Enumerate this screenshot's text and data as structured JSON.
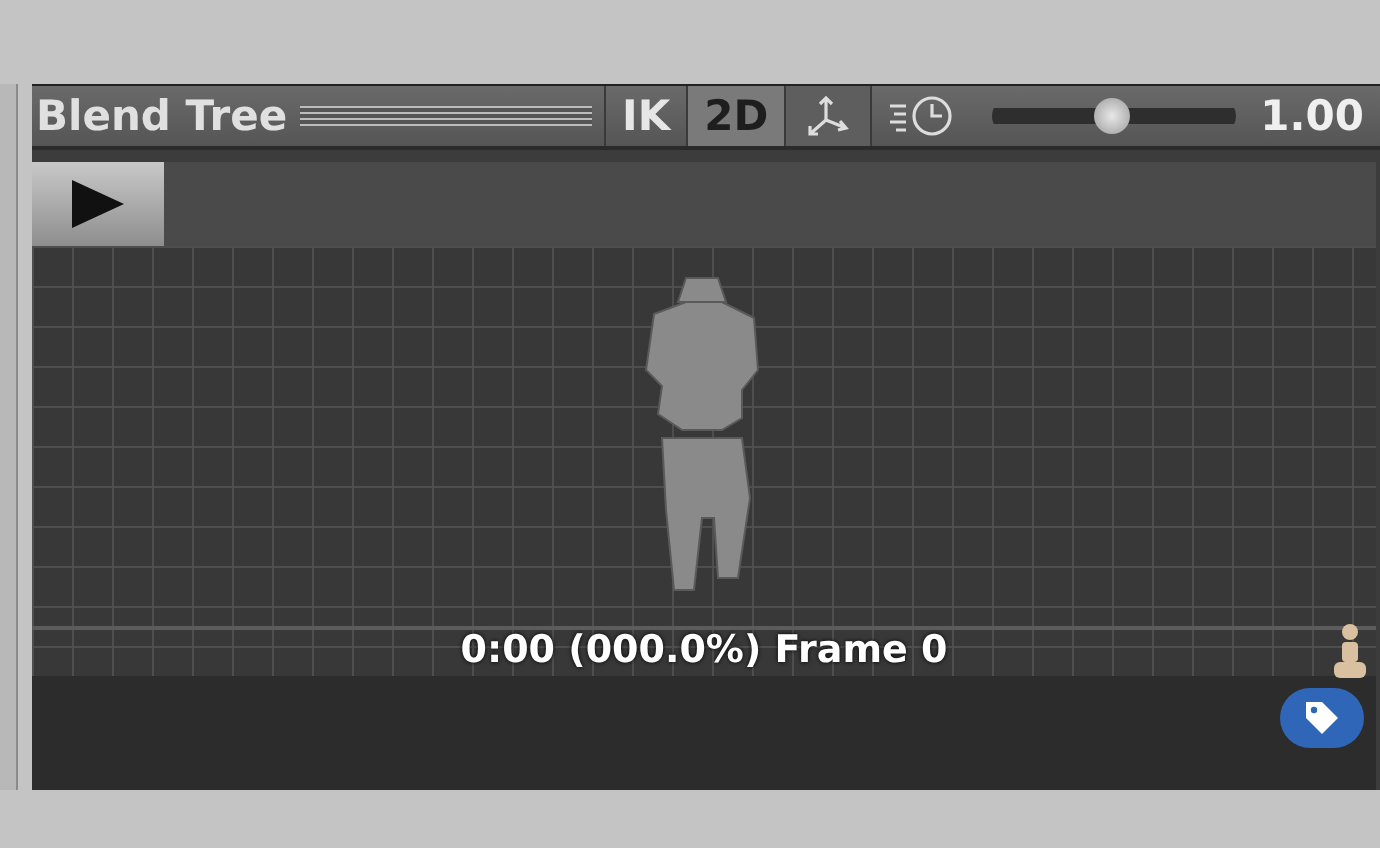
{
  "toolbar": {
    "title": "Blend Tree",
    "toggles": [
      {
        "label": "IK",
        "selected": false
      },
      {
        "label": "2D",
        "selected": true
      }
    ],
    "pivot_toggle": {
      "selected": false
    },
    "speed": {
      "level": 0.49,
      "reading": "1.00"
    }
  },
  "preview": {
    "status": "0:00 (000.0%) Frame 0"
  }
}
